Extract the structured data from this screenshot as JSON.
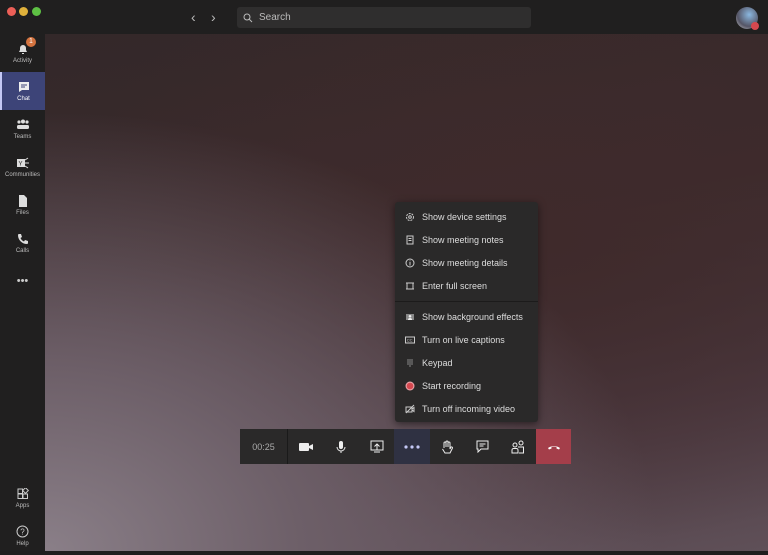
{
  "window": {
    "controls": [
      "close",
      "minimize",
      "maximize"
    ]
  },
  "header": {
    "search_placeholder": "Search",
    "back": "‹",
    "forward": "›"
  },
  "sidebar": {
    "items": [
      {
        "label": "Activity",
        "icon": "bell-icon",
        "badge": "1"
      },
      {
        "label": "Chat",
        "icon": "chat-icon",
        "active": true
      },
      {
        "label": "Teams",
        "icon": "teams-icon"
      },
      {
        "label": "Communities",
        "icon": "yammer-icon"
      },
      {
        "label": "Files",
        "icon": "file-icon"
      },
      {
        "label": "Calls",
        "icon": "phone-icon"
      },
      {
        "label": "•••",
        "icon": "more-icon"
      }
    ],
    "bottom": [
      {
        "label": "Apps",
        "icon": "apps-icon"
      },
      {
        "label": "Help",
        "icon": "help-icon"
      }
    ]
  },
  "menu": {
    "items": [
      {
        "label": "Show device settings",
        "icon": "gear-icon"
      },
      {
        "label": "Show meeting notes",
        "icon": "notes-icon"
      },
      {
        "label": "Show meeting details",
        "icon": "info-icon"
      },
      {
        "label": "Enter full screen",
        "icon": "fullscreen-icon"
      },
      {
        "label": "Show background effects",
        "icon": "background-icon"
      },
      {
        "label": "Turn on live captions",
        "icon": "captions-icon"
      },
      {
        "label": "Keypad",
        "icon": "keypad-icon"
      },
      {
        "label": "Start recording",
        "icon": "record-icon"
      },
      {
        "label": "Turn off incoming video",
        "icon": "video-off-icon"
      }
    ]
  },
  "call_controls": {
    "timer": "00:25"
  },
  "colors": {
    "accent": "#3d4478",
    "hangup": "#a43e4a",
    "record": "#d5484f",
    "badge": "#d4733f"
  }
}
